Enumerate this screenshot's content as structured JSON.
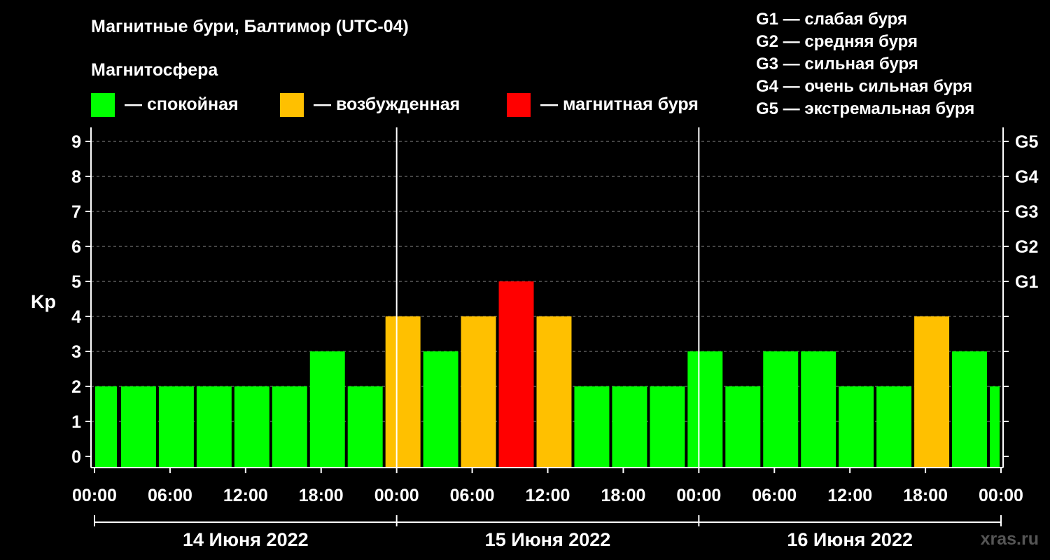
{
  "header": {
    "title": "Магнитные бури, Балтимор (UTC-04)",
    "subtitle": "Магнитосфера"
  },
  "legend": [
    {
      "label": "— спокойная",
      "color": "#00ff00"
    },
    {
      "label": "— возбужденная",
      "color": "#ffc000"
    },
    {
      "label": "— магнитная буря",
      "color": "#ff0000"
    }
  ],
  "storm_scale": [
    "G1 — слабая буря",
    "G2 — средняя буря",
    "G3 — сильная буря",
    "G4 — очень сильная буря",
    "G5 — экстремальная буря"
  ],
  "watermark": "xras.ru",
  "chart_data": {
    "type": "bar",
    "ylabel": "Kp",
    "ylim": [
      0,
      9
    ],
    "yticks": [
      "0",
      "1",
      "2",
      "3",
      "4",
      "5",
      "6",
      "7",
      "8",
      "9"
    ],
    "right_ticks": [
      {
        "kp": 5,
        "label": "G1"
      },
      {
        "kp": 6,
        "label": "G2"
      },
      {
        "kp": 7,
        "label": "G3"
      },
      {
        "kp": 8,
        "label": "G4"
      },
      {
        "kp": 9,
        "label": "G5"
      }
    ],
    "xticks": [
      "00:00",
      "06:00",
      "12:00",
      "18:00",
      "00:00",
      "06:00",
      "12:00",
      "18:00",
      "00:00",
      "06:00",
      "12:00",
      "18:00",
      "00:00"
    ],
    "days": [
      "14 Июня 2022",
      "15 Июня 2022",
      "16 Июня 2022"
    ],
    "grid": "horizontal dashed",
    "bars": [
      {
        "start_hour": 0,
        "value": 2
      },
      {
        "start_hour": 2,
        "value": 2
      },
      {
        "start_hour": 5,
        "value": 2
      },
      {
        "start_hour": 8,
        "value": 2
      },
      {
        "start_hour": 11,
        "value": 2
      },
      {
        "start_hour": 14,
        "value": 2
      },
      {
        "start_hour": 17,
        "value": 3
      },
      {
        "start_hour": 20,
        "value": 2
      },
      {
        "start_hour": 23,
        "value": 4
      },
      {
        "start_hour": 26,
        "value": 3
      },
      {
        "start_hour": 29,
        "value": 4
      },
      {
        "start_hour": 32,
        "value": 5
      },
      {
        "start_hour": 35,
        "value": 4
      },
      {
        "start_hour": 38,
        "value": 2
      },
      {
        "start_hour": 41,
        "value": 2
      },
      {
        "start_hour": 44,
        "value": 2
      },
      {
        "start_hour": 47,
        "value": 3
      },
      {
        "start_hour": 50,
        "value": 2
      },
      {
        "start_hour": 53,
        "value": 3
      },
      {
        "start_hour": 56,
        "value": 3
      },
      {
        "start_hour": 59,
        "value": 2
      },
      {
        "start_hour": 62,
        "value": 2
      },
      {
        "start_hour": 65,
        "value": 4
      },
      {
        "start_hour": 68,
        "value": 3
      },
      {
        "start_hour": 71,
        "value": 2
      }
    ],
    "colors": {
      "quiet": "#00ff00",
      "active": "#ffc000",
      "storm": "#ff0000"
    }
  }
}
